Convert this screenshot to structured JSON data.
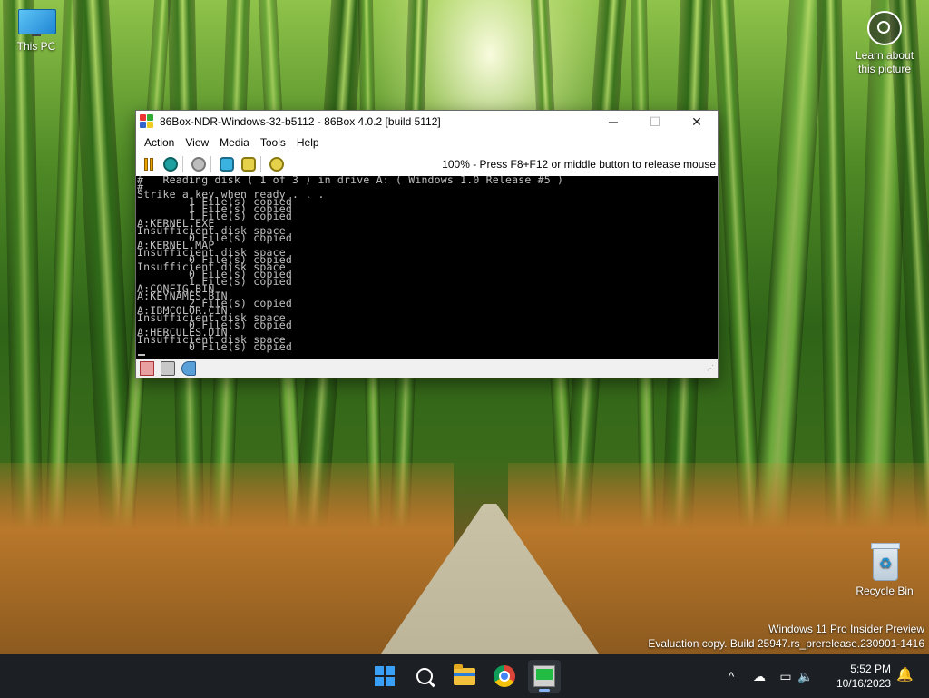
{
  "desktop": {
    "icons": {
      "this_pc": "This PC",
      "learn_about": "Learn about\nthis picture",
      "recycle_bin": "Recycle Bin"
    },
    "watermark": {
      "line1": "Windows 11 Pro Insider Preview",
      "line2": "Evaluation copy. Build 25947.rs_prerelease.230901-1416"
    }
  },
  "window": {
    "title": "86Box-NDR-Windows-32-b5112 - 86Box 4.0.2 [build 5112]",
    "controls": {
      "minimize": "─",
      "maximize": "☐",
      "close": "✕"
    },
    "menu": [
      "Action",
      "View",
      "Media",
      "Tools",
      "Help"
    ],
    "toolbar": {
      "icons": [
        "pause-icon",
        "hard-reset-icon",
        "power-icon",
        "settings-icon",
        "ctrl-alt-del-icon",
        "ctrl-alt-esc-icon"
      ],
      "status_message": "100% - Press F8+F12 or middle button to release mouse"
    },
    "screen_text": "#   Reading disk ( 1 of 3 ) in drive A: ( Windows 1.0 Release #5 )\n#\nStrike a key when ready . . .\n        1 File(s) copied\n        1 File(s) copied\n        1 File(s) copied\nA:KERNEL.EXE\nInsufficient disk space\n        0 File(s) copied\nA:KERNEL.MAP\nInsufficient disk space\n        0 File(s) copied\nInsufficient disk space\n        0 File(s) copied\n        1 File(s) copied\nA:CONFIG.BIN\nA:KEYNAMES.BIN\n        2 File(s) copied\nA:IBMCOLOR.CIN\nInsufficient disk space\n        0 File(s) copied\nA:HERCULES.DIN\nInsufficient disk space\n        0 File(s) copied",
    "statusbar_icons": [
      "floppy-drive-icon",
      "hard-disk-icon",
      "sound-icon"
    ]
  },
  "taskbar": {
    "apps": [
      "start-button",
      "search-button",
      "file-explorer",
      "chrome",
      "86box"
    ],
    "clock": {
      "time": "5:52 PM",
      "date": "10/16/2023"
    },
    "tray": {
      "chevron": "^"
    }
  }
}
